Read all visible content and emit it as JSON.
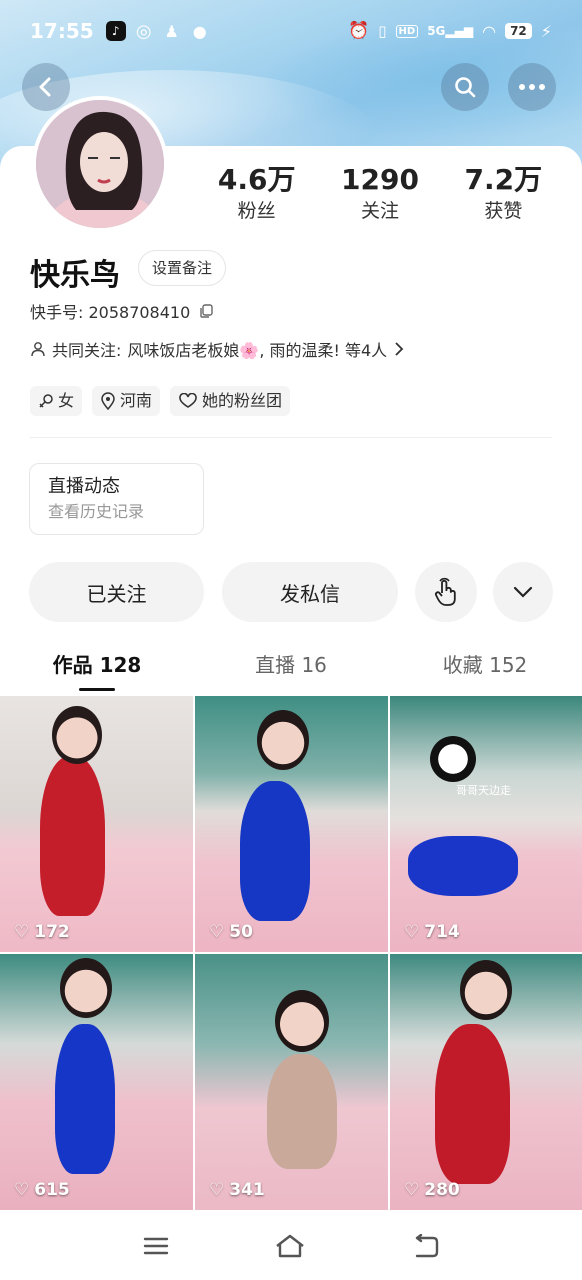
{
  "status_bar": {
    "time": "17:55",
    "signal": "5G",
    "hd": "HD",
    "battery": "72"
  },
  "profile": {
    "name": "快乐鸟",
    "remark_button": "设置备注",
    "uid_label": "快手号: 2058708410",
    "mutual_prefix": "共同关注:",
    "mutual_names": "风味饭店老板娘🌸, 雨的温柔! 等4人",
    "stats": [
      {
        "value": "4.6万",
        "label": "粉丝"
      },
      {
        "value": "1290",
        "label": "关注"
      },
      {
        "value": "7.2万",
        "label": "获赞"
      }
    ],
    "tags": [
      {
        "icon": "female-icon",
        "label": "女"
      },
      {
        "icon": "location-icon",
        "label": "河南"
      },
      {
        "icon": "heart-outline-icon",
        "label": "她的粉丝团"
      }
    ]
  },
  "live_box": {
    "title": "直播动态",
    "subtitle": "查看历史记录"
  },
  "actions": {
    "followed": "已关注",
    "message": "发私信"
  },
  "tabs": [
    {
      "label": "作品 128"
    },
    {
      "label": "直播 16"
    },
    {
      "label": "收藏 152"
    }
  ],
  "videos": [
    {
      "likes": "172",
      "outfit": "#c41e2a"
    },
    {
      "likes": "50",
      "outfit": "#1537c4"
    },
    {
      "likes": "714",
      "outfit": "#1a36c8",
      "watermark": "哥哥天边走"
    },
    {
      "likes": "615",
      "outfit": "#1536c6"
    },
    {
      "likes": "341",
      "outfit": "#c8a99a"
    },
    {
      "likes": "280",
      "outfit": "#c11a28"
    }
  ],
  "colors": {
    "hero": "#a9d6f0",
    "button_bg": "#f3f3f3"
  }
}
